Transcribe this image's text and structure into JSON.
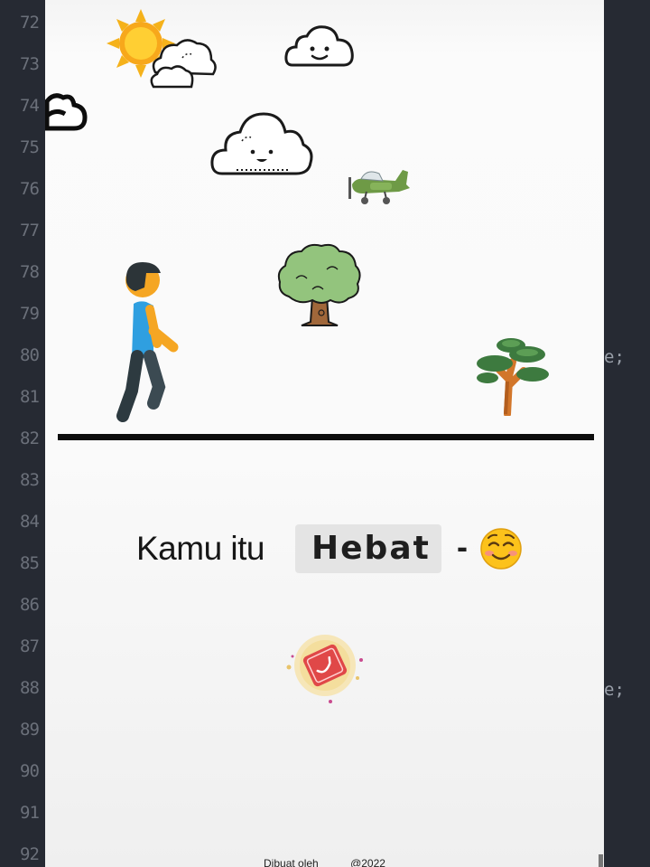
{
  "editor": {
    "line_numbers": [
      "72",
      "73",
      "74",
      "75",
      "76",
      "77",
      "78",
      "79",
      "80",
      "81",
      "82",
      "83",
      "84",
      "85",
      "86",
      "87",
      "88",
      "89",
      "90",
      "91",
      "92"
    ],
    "code_fragments": [
      "e;",
      "e;"
    ]
  },
  "preview": {
    "headline_prefix": "Kamu itu",
    "highlight_word": "Hebat",
    "headline_suffix": "-",
    "footer_author": "Dibuat oleh",
    "footer_year": "@2022"
  },
  "colors": {
    "sun": "#f5b21b",
    "shirt": "#2f9fe0",
    "skin": "#f5a623",
    "pants": "#2d3a40",
    "hair": "#2c3438",
    "tree_leaf": "#93c47d",
    "tree_trunk": "#a0673a",
    "plane": "#6e9a46",
    "badge_red": "#e04848"
  },
  "icons": [
    "sun-icon",
    "cloud-icon",
    "smiling-cloud-icon",
    "airplane-icon",
    "walking-person-icon",
    "tree-icon",
    "small-tree-icon",
    "blushing-emoji-icon",
    "badge-icon"
  ]
}
